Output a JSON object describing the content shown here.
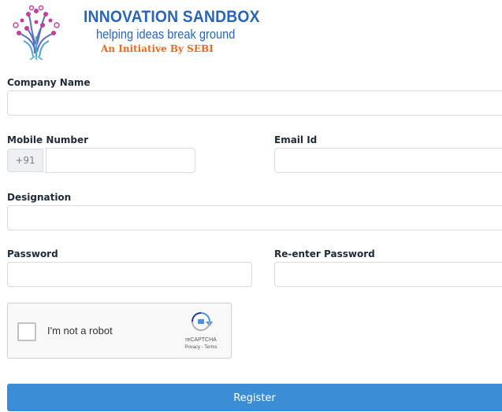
{
  "brand": {
    "title": "INNOVATION SANDBOX",
    "tagline": "helping ideas break ground",
    "subtitle": "An Initiative By SEBI"
  },
  "form": {
    "company_name_label": "Company Name",
    "mobile_label": "Mobile Number",
    "mobile_prefix": "+91",
    "email_label": "Email Id",
    "designation_label": "Designation",
    "password_label": "Password",
    "reenter_password_label": "Re-enter Password",
    "register_label": "Register"
  },
  "recaptcha": {
    "label": "I'm not a robot",
    "brand": "reCAPTCHA",
    "links": "Privacy - Terms"
  },
  "colors": {
    "brand_blue": "#2a66b8",
    "brand_orange": "#f26a1b",
    "button": "#3b8ed6"
  }
}
